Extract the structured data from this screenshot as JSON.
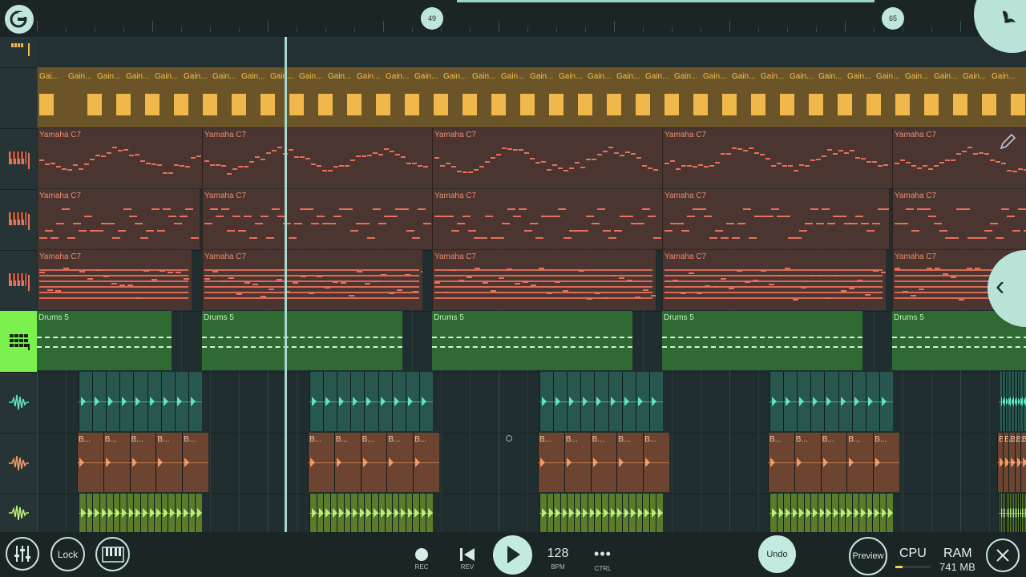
{
  "timeline": {
    "markers": [
      "49",
      "65"
    ]
  },
  "tracks": {
    "gain": {
      "clip_label": "Gai...",
      "clip_label_alt": "Gain..."
    },
    "piano": {
      "clip_label": "Yamaha C7"
    },
    "drums": {
      "clip_label": "Drums 5"
    },
    "audio_orange": {
      "clip_label": "B..."
    }
  },
  "icons": {
    "logo": "fl-studio-logo-icon",
    "fl_fruit": "fl-fruit-icon",
    "pencil": "pencil-icon",
    "collapse": "chevron-left-icon",
    "piano_track": "piano-keys-icon",
    "drum_track": "drum-grid-icon",
    "audio_track": "waveform-icon",
    "mixer": "mixer-icon",
    "keyboard": "keyboard-icon",
    "close": "close-icon"
  },
  "colors": {
    "accent": "#b9e3d8",
    "gain": "#f0b84a",
    "piano_notes": "#e9705a",
    "drums": "#2f6a33",
    "drums_selected": "#7cf04d"
  },
  "transport": {
    "rec_label": "REC",
    "rev_label": "REV",
    "bpm_value": "128",
    "bpm_label": "BPM",
    "ctrl_label": "CTRL"
  },
  "bottombar": {
    "lock_label": "Lock",
    "undo_label": "Undo",
    "preview_label": "Preview",
    "cpu_label": "CPU",
    "cpu_level": 0.2,
    "ram_label": "RAM",
    "ram_value": "741 MB"
  }
}
